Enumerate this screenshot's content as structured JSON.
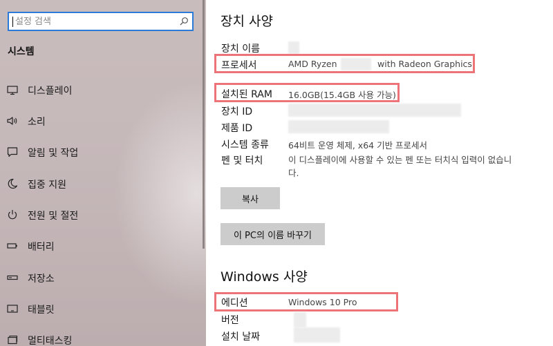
{
  "sidebar": {
    "search": {
      "placeholder": "설정 검색",
      "value": ""
    },
    "title": "시스템",
    "items": [
      {
        "label": "디스플레이",
        "icon": "monitor-icon"
      },
      {
        "label": "소리",
        "icon": "speaker-icon"
      },
      {
        "label": "알림 및 작업",
        "icon": "notification-icon"
      },
      {
        "label": "집중 지원",
        "icon": "moon-icon"
      },
      {
        "label": "전원 및 절전",
        "icon": "power-icon"
      },
      {
        "label": "배터리",
        "icon": "battery-icon"
      },
      {
        "label": "저장소",
        "icon": "storage-icon"
      },
      {
        "label": "태블릿",
        "icon": "tablet-icon"
      },
      {
        "label": "멀티태스킹",
        "icon": "multitasking-icon"
      }
    ]
  },
  "device_specs": {
    "title": "장치 사양",
    "rows": [
      {
        "label": "장치 이름",
        "value": ""
      },
      {
        "label": "프로세서",
        "value_prefix": "AMD Ryzen",
        "value_suffix": "with Radeon Graphics"
      },
      {
        "label": "설치된 RAM",
        "value": "16.0GB(15.4GB 사용 가능)"
      },
      {
        "label": "장치 ID",
        "value": ""
      },
      {
        "label": "제품 ID",
        "value": ""
      },
      {
        "label": "시스템 종류",
        "value": "64비트 운영 체제, x64 기반 프로세서"
      },
      {
        "label": "펜 및 터치",
        "value": "이 디스플레이에 사용할 수 있는 펜 또는 터치식 입력이 없습니다."
      }
    ],
    "copy_button": "복사",
    "rename_button": "이 PC의 이름 바꾸기"
  },
  "windows_specs": {
    "title": "Windows 사양",
    "rows": [
      {
        "label": "에디션",
        "value": "Windows 10 Pro"
      },
      {
        "label": "버전",
        "value": ""
      },
      {
        "label": "설치 날짜",
        "value": ""
      }
    ]
  },
  "colors": {
    "highlight": "#ec7479",
    "search_border": "#2b7ad8",
    "button_bg": "#cccccc"
  }
}
